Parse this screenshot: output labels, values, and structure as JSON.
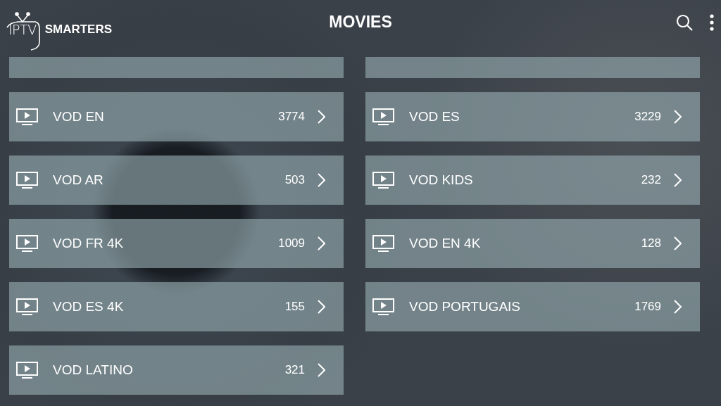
{
  "header": {
    "logo": {
      "prefix": "IPTV",
      "suffix": "SMARTERS"
    },
    "title": "MOVIES"
  },
  "categories": [
    {
      "name": "VOD EN",
      "count": "3774"
    },
    {
      "name": "VOD ES",
      "count": "3229"
    },
    {
      "name": "VOD AR",
      "count": "503"
    },
    {
      "name": "VOD KIDS",
      "count": "232"
    },
    {
      "name": "VOD FR 4K",
      "count": "1009"
    },
    {
      "name": "VOD EN 4K",
      "count": "128"
    },
    {
      "name": "VOD ES 4K",
      "count": "155"
    },
    {
      "name": "VOD PORTUGAIS",
      "count": "1769"
    },
    {
      "name": "VOD LATINO",
      "count": "321"
    }
  ]
}
